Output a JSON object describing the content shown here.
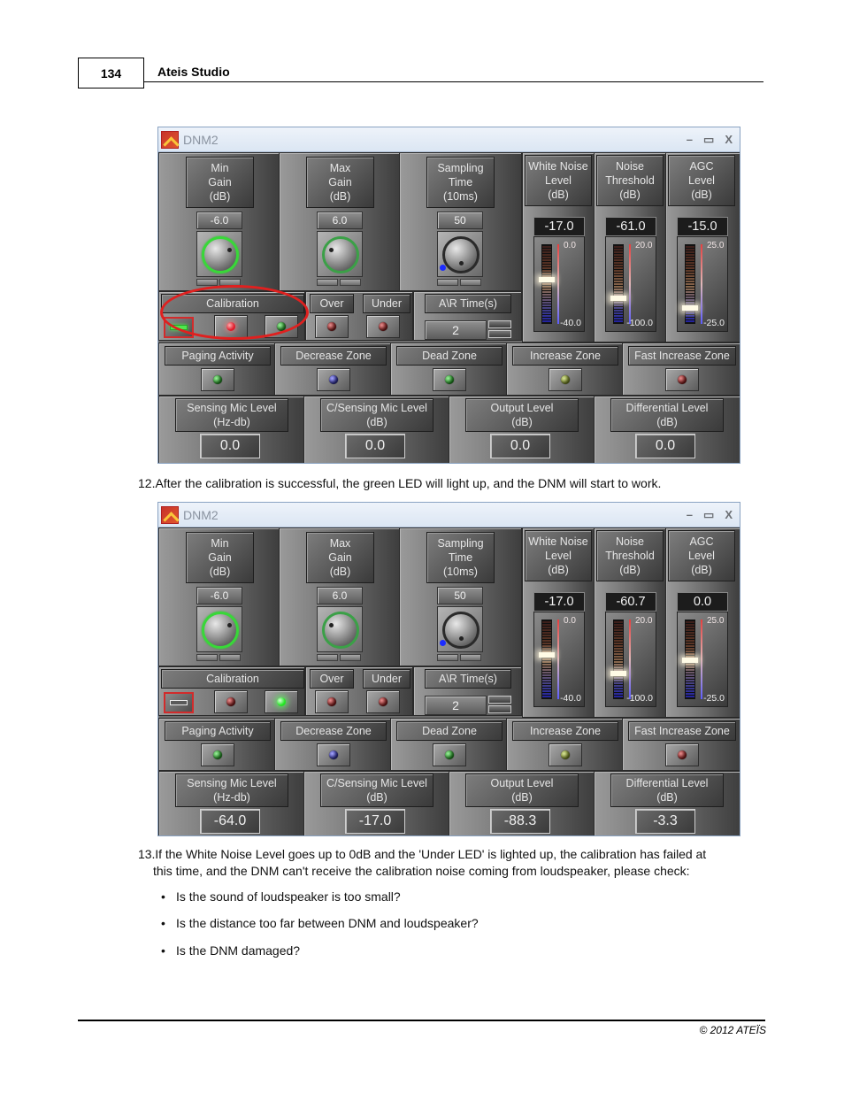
{
  "page": {
    "number": "134",
    "title": "Ateis Studio",
    "footer": "© 2012 ATEÏS"
  },
  "windows": [
    {
      "title": "DNM2",
      "controls": {
        "minimize": "–",
        "maximize": "▭",
        "close": "X"
      },
      "knobs": [
        {
          "label": [
            "Min",
            "Gain",
            "(dB)"
          ],
          "value": "-6.0",
          "ring": "green"
        },
        {
          "label": [
            "Max",
            "Gain",
            "(dB)"
          ],
          "value": "6.0",
          "ring": "dark-green"
        },
        {
          "label": [
            "Sampling",
            "Time",
            "(10ms)"
          ],
          "value": "50",
          "ring": "none"
        }
      ],
      "meters": [
        {
          "label": [
            "White Noise",
            "Level",
            "(dB)"
          ],
          "value": "-17.0",
          "scale_max": "0.0",
          "scale_min": "-40.0",
          "level_fraction": 0.575
        },
        {
          "label": [
            "Noise",
            "Threshold",
            "(dB)"
          ],
          "value": "-61.0",
          "scale_max": "20.0",
          "scale_min": "-100.0",
          "level_fraction": 0.325
        },
        {
          "label": [
            "AGC",
            "Level",
            "(dB)"
          ],
          "value": "-15.0",
          "scale_max": "25.0",
          "scale_min": "-25.0",
          "level_fraction": 0.2
        }
      ],
      "calibration": {
        "label": "Calibration",
        "toggle_on": true,
        "red_led_on": true,
        "green_led_on": false
      },
      "over": {
        "label": "Over",
        "led_on": false
      },
      "under": {
        "label": "Under",
        "led_on": false
      },
      "ar_time": {
        "label": "A\\R Time(s)",
        "value": "2"
      },
      "indicators": [
        {
          "label": "Paging Activity",
          "color": "green"
        },
        {
          "label": "Decrease Zone",
          "color": "blue"
        },
        {
          "label": "Dead Zone",
          "color": "green"
        },
        {
          "label": "Increase Zone",
          "color": "olive"
        },
        {
          "label": "Fast Increase Zone",
          "color": "red"
        }
      ],
      "readouts": [
        {
          "label": [
            "Sensing Mic Level",
            "(Hz-db)"
          ],
          "value": "0.0"
        },
        {
          "label": [
            "C/Sensing Mic Level",
            "(dB)"
          ],
          "value": "0.0"
        },
        {
          "label": [
            "Output Level",
            "(dB)"
          ],
          "value": "0.0"
        },
        {
          "label": [
            "Differential Level",
            "(dB)"
          ],
          "value": "0.0"
        }
      ],
      "highlight": "calibration"
    },
    {
      "title": "DNM2",
      "controls": {
        "minimize": "–",
        "maximize": "▭",
        "close": "X"
      },
      "knobs": [
        {
          "label": [
            "Min",
            "Gain",
            "(dB)"
          ],
          "value": "-6.0",
          "ring": "green"
        },
        {
          "label": [
            "Max",
            "Gain",
            "(dB)"
          ],
          "value": "6.0",
          "ring": "dark-green"
        },
        {
          "label": [
            "Sampling",
            "Time",
            "(10ms)"
          ],
          "value": "50",
          "ring": "none"
        }
      ],
      "meters": [
        {
          "label": [
            "White Noise",
            "Level",
            "(dB)"
          ],
          "value": "-17.0",
          "scale_max": "0.0",
          "scale_min": "-40.0",
          "level_fraction": 0.575
        },
        {
          "label": [
            "Noise",
            "Threshold",
            "(dB)"
          ],
          "value": "-60.7",
          "scale_max": "20.0",
          "scale_min": "-100.0",
          "level_fraction": 0.33
        },
        {
          "label": [
            "AGC",
            "Level",
            "(dB)"
          ],
          "value": "0.0",
          "scale_max": "25.0",
          "scale_min": "-25.0",
          "level_fraction": 0.5
        }
      ],
      "calibration": {
        "label": "Calibration",
        "toggle_on": false,
        "red_led_on": false,
        "green_led_on": true
      },
      "over": {
        "label": "Over",
        "led_on": false
      },
      "under": {
        "label": "Under",
        "led_on": false
      },
      "ar_time": {
        "label": "A\\R Time(s)",
        "value": "2"
      },
      "indicators": [
        {
          "label": "Paging Activity",
          "color": "green"
        },
        {
          "label": "Decrease Zone",
          "color": "blue"
        },
        {
          "label": "Dead Zone",
          "color": "green"
        },
        {
          "label": "Increase Zone",
          "color": "olive"
        },
        {
          "label": "Fast Increase Zone",
          "color": "red"
        }
      ],
      "readouts": [
        {
          "label": [
            "Sensing Mic Level",
            "(Hz-db)"
          ],
          "value": "-64.0"
        },
        {
          "label": [
            "C/Sensing Mic Level",
            "(dB)"
          ],
          "value": "-17.0"
        },
        {
          "label": [
            "Output Level",
            "(dB)"
          ],
          "value": "-88.3"
        },
        {
          "label": [
            "Differential Level",
            "(dB)"
          ],
          "value": "-3.3"
        }
      ],
      "highlight": null
    }
  ],
  "text": {
    "step12": "12.After the calibration is successful, the green LED will light up, and the DNM will start to work.",
    "step13_line1": "13.If the White Noise Level goes up to 0dB and the 'Under LED' is lighted up, the calibration has failed at",
    "step13_line2": "this time, and the DNM can't receive the calibration noise coming from loudspeaker, please check:",
    "bullets": [
      "Is the sound of loudspeaker is too small?",
      "Is the distance  too far between DNM and loudspeaker?",
      "Is the DNM damaged?"
    ]
  }
}
